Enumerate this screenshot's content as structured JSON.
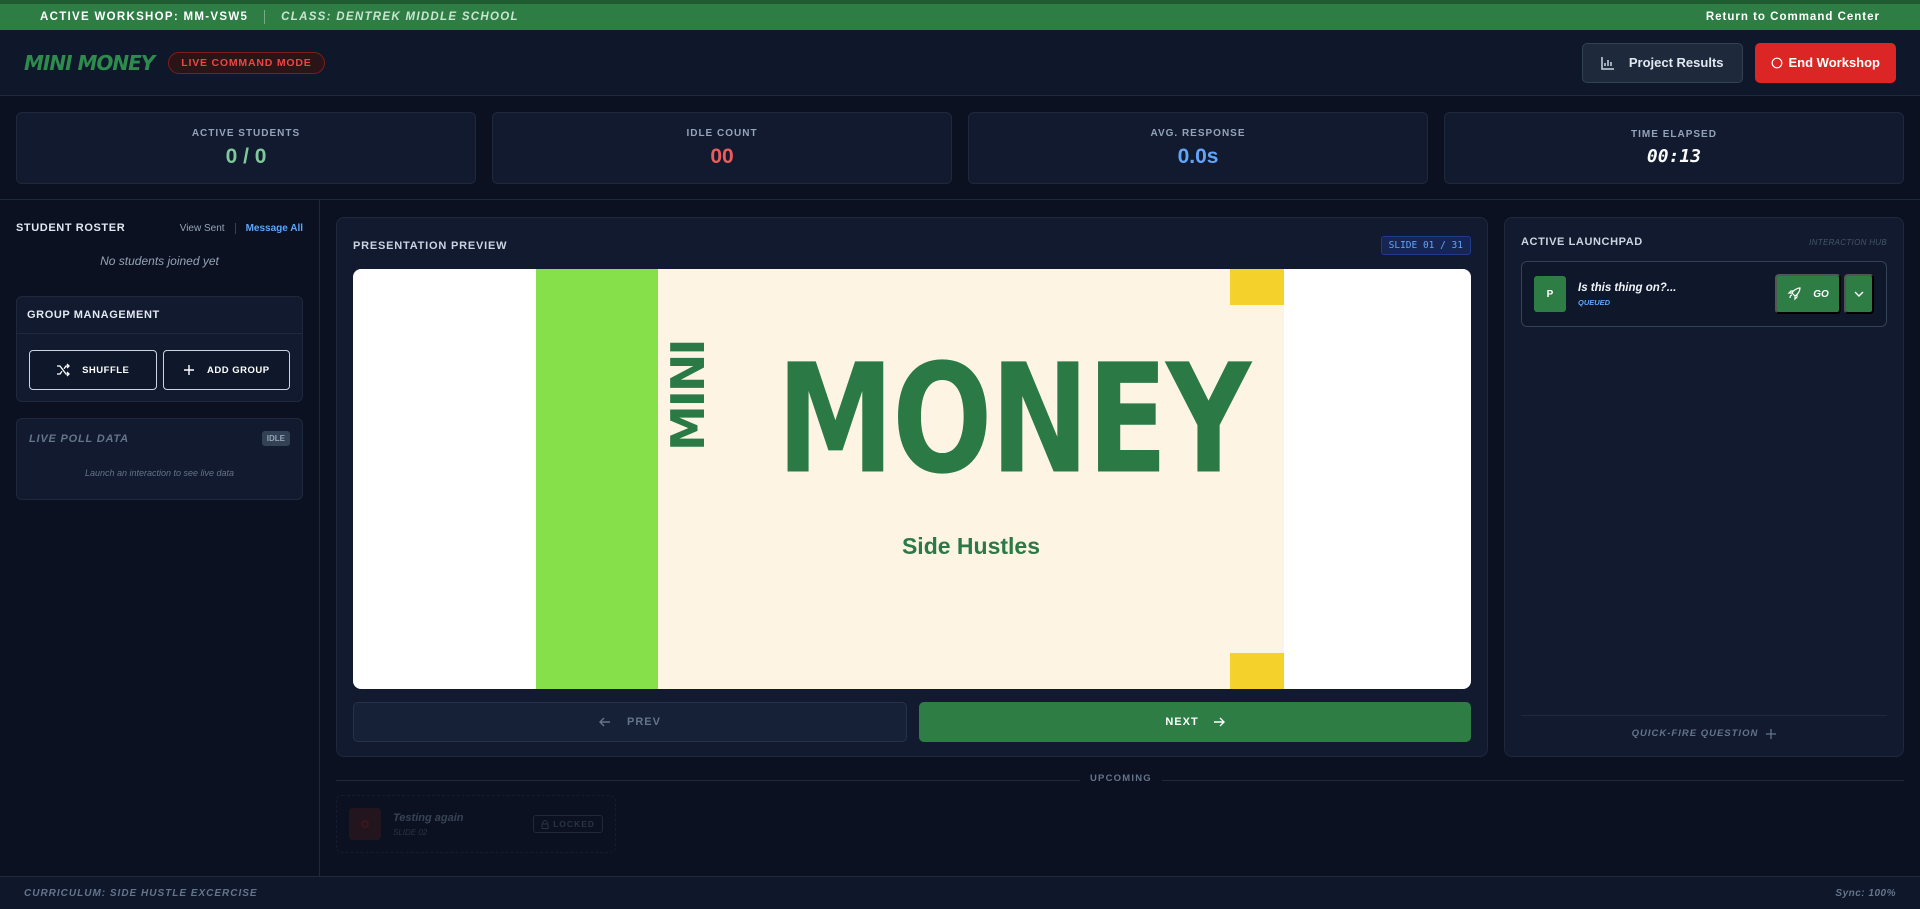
{
  "topbar": {
    "workshop": "ACTIVE WORKSHOP: MM-VSW5",
    "class_name": "CLASS: DENTREK MIDDLE SCHOOL",
    "return_link": "Return to Command Center"
  },
  "header": {
    "logo": "MINI MONEY",
    "mode_badge": "LIVE COMMAND MODE",
    "results_button": "Project Results",
    "end_button": "End Workshop"
  },
  "stats": [
    {
      "label": "ACTIVE STUDENTS",
      "value": "0 / 0"
    },
    {
      "label": "IDLE COUNT",
      "value": "00"
    },
    {
      "label": "AVG. RESPONSE",
      "value": "0.0s"
    },
    {
      "label": "TIME ELAPSED",
      "value": "00:13"
    }
  ],
  "sidebar": {
    "roster_title": "STUDENT ROSTER",
    "view_sent": "View Sent",
    "message_all": "Message All",
    "empty_message": "No students joined yet",
    "group_title": "GROUP MANAGEMENT",
    "shuffle_label": "SHUFFLE",
    "add_group_label": "ADD GROUP",
    "poll_title": "LIVE POLL DATA",
    "poll_status": "IDLE",
    "poll_message": "Launch an interaction to see live data"
  },
  "presentation": {
    "title": "PRESENTATION PREVIEW",
    "slide_counter": "SLIDE 01 / 31",
    "slide_mini": "MINI",
    "slide_money": "MONEY",
    "slide_subtitle": "Side Hustles",
    "prev_label": "PREV",
    "next_label": "NEXT"
  },
  "upcoming": {
    "label": "UPCOMING",
    "item_title": "Testing again",
    "item_slide": "SLIDE 02",
    "item_status": "LOCKED"
  },
  "launchpad": {
    "title": "ACTIVE LAUNCHPAD",
    "subtitle": "INTERACTION HUB",
    "card_avatar": "P",
    "card_question": "Is this thing on?...",
    "card_status": "QUEUED",
    "go_label": "GO",
    "quick_fire": "QUICK-FIRE QUESTION"
  },
  "footer": {
    "curriculum": "CURRICULUM: SIDE HUSTLE EXCERCISE",
    "sync": "Sync: 100%"
  },
  "colors": {
    "brand_green": "#2e7d45",
    "danger_red": "#dc2626",
    "accent_blue": "#60a5fa",
    "slide_lime": "#86e04a",
    "slide_yellow": "#f4d12b"
  }
}
